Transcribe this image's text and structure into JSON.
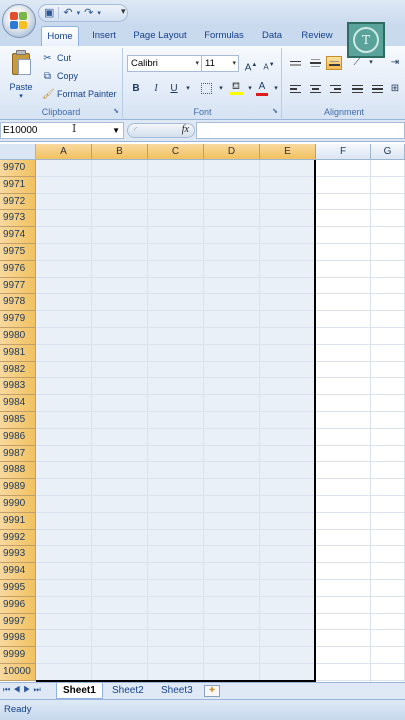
{
  "qat": {
    "save_icon": "save-icon",
    "undo_icon": "undo-icon",
    "redo_icon": "redo-icon",
    "more": "▾"
  },
  "tabs": [
    {
      "label": "Home",
      "active": true
    },
    {
      "label": "Insert"
    },
    {
      "label": "Page Layout"
    },
    {
      "label": "Formulas"
    },
    {
      "label": "Data"
    },
    {
      "label": "Review"
    }
  ],
  "avatar": {
    "initial": "T"
  },
  "ribbon": {
    "clipboard": {
      "label": "Clipboard",
      "paste": "Paste",
      "cut": "Cut",
      "copy": "Copy",
      "format_painter": "Format Painter"
    },
    "font": {
      "label": "Font",
      "font_name": "Calibri",
      "font_size": "11",
      "bold": "B",
      "italic": "I",
      "underline": "U",
      "grow": "A",
      "shrink": "A",
      "font_color": "A"
    },
    "alignment": {
      "label": "Alignment"
    }
  },
  "formula_bar": {
    "name_box": "E10000",
    "fx": "fx",
    "value": ""
  },
  "grid": {
    "columns": [
      "A",
      "B",
      "C",
      "D",
      "E",
      "F",
      "G"
    ],
    "rows": [
      "9970",
      "9971",
      "9972",
      "9973",
      "9974",
      "9975",
      "9976",
      "9977",
      "9978",
      "9979",
      "9980",
      "9981",
      "9982",
      "9983",
      "9984",
      "9985",
      "9986",
      "9987",
      "9988",
      "9989",
      "9990",
      "9991",
      "9992",
      "9993",
      "9994",
      "9995",
      "9996",
      "9997",
      "9998",
      "9999",
      "10000"
    ]
  },
  "sheets": [
    {
      "label": "Sheet1",
      "active": true
    },
    {
      "label": "Sheet2"
    },
    {
      "label": "Sheet3"
    }
  ],
  "status": {
    "text": "Ready"
  },
  "colors": {
    "selection_header": "#f1c15f",
    "selection_fill": "#eaf0f8",
    "ribbon": "#dfe9f5"
  }
}
